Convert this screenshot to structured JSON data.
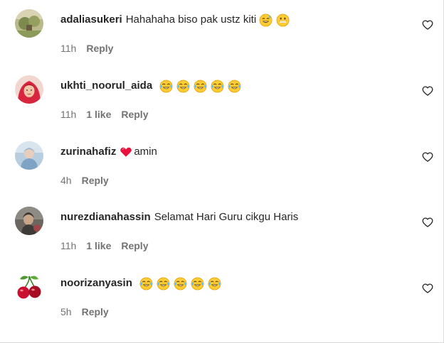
{
  "accent_colors": {
    "text": "#262626",
    "secondary": "#737373",
    "border": "#dbdbdb",
    "heart": "#e0245e"
  },
  "comments": [
    {
      "username": "adaliasukeri",
      "text": "Hahahaha biso pak ustz kiti",
      "emojis": [
        "sweat-smile-emoji",
        "grinning-emoji"
      ],
      "time": "11h",
      "likes": "",
      "reply_label": "Reply",
      "avatar": "nature-photo-avatar"
    },
    {
      "username": "ukhti_noorul_aida",
      "text": "",
      "emojis": [
        "tears-of-joy-emoji",
        "tears-of-joy-emoji",
        "tears-of-joy-emoji",
        "tears-of-joy-emoji",
        "tears-of-joy-emoji"
      ],
      "time": "11h",
      "likes": "1 like",
      "reply_label": "Reply",
      "avatar": "red-hijab-avatar"
    },
    {
      "username": "zurinahafiz",
      "text": "amin",
      "emojis": [
        "red-heart-emoji"
      ],
      "time": "4h",
      "likes": "",
      "reply_label": "Reply",
      "avatar": "blue-photo-avatar"
    },
    {
      "username": "nurezdianahassin",
      "text": "Selamat Hari Guru cikgu Haris",
      "emojis": [],
      "time": "11h",
      "likes": "1 like",
      "reply_label": "Reply",
      "avatar": "dark-photo-avatar"
    },
    {
      "username": "noorizanyasin",
      "text": "",
      "emojis": [
        "tears-of-joy-emoji",
        "tears-of-joy-emoji",
        "tears-of-joy-emoji",
        "tears-of-joy-emoji",
        "tears-of-joy-emoji"
      ],
      "time": "5h",
      "likes": "",
      "reply_label": "Reply",
      "avatar": "cherries-avatar"
    }
  ],
  "like_icon": "heart-outline-icon"
}
